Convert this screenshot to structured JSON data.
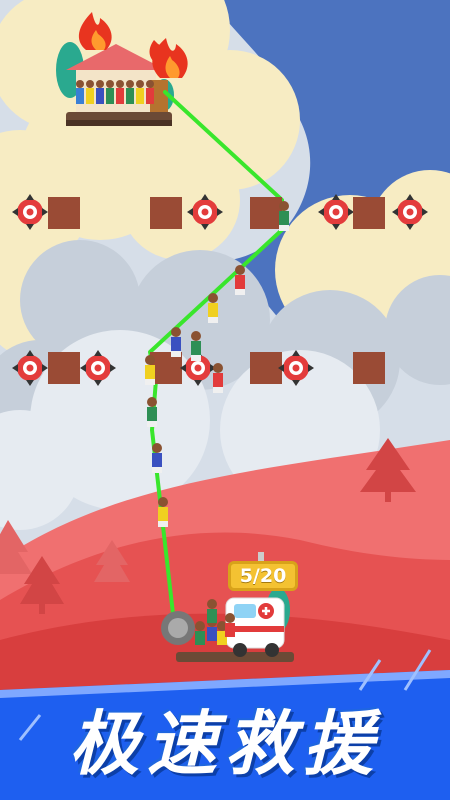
{
  "hud": {
    "counter": "5/20"
  },
  "banner": {
    "title": "极速救援"
  },
  "colors": {
    "rope": "#39e62c",
    "fire": "#e8341f",
    "hill_red": "#e85050",
    "banner_blue": "#1e5ff0",
    "counter_gold": "#f4c232"
  },
  "icons": {
    "fire": "fire-icon",
    "spike": "spike-mine-icon",
    "block": "dirt-block-icon",
    "ambulance": "ambulance-icon",
    "house": "burning-house-icon",
    "tree": "tree-icon"
  }
}
